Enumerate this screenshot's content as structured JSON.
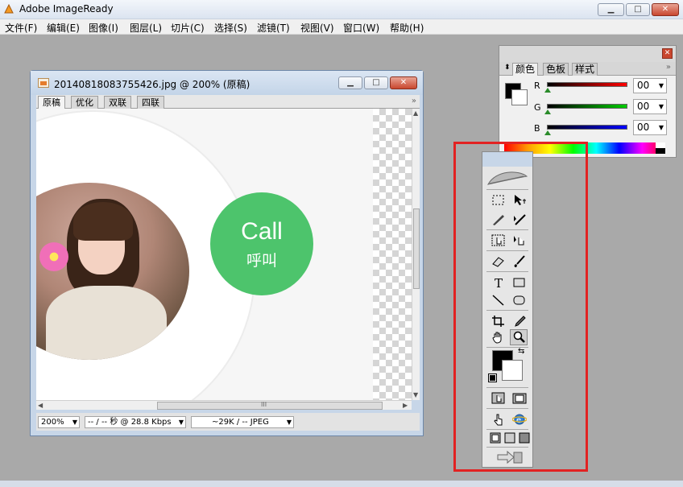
{
  "app": {
    "title": "Adobe ImageReady"
  },
  "menu": [
    "文件(F)",
    "编辑(E)",
    "图像(I)",
    "图层(L)",
    "切片(C)",
    "选择(S)",
    "滤镜(T)",
    "视图(V)",
    "窗口(W)",
    "帮助(H)"
  ],
  "document": {
    "title": "20140818083755426.jpg @ 200% (原稿)",
    "tabs": [
      "原稿",
      "优化",
      "双联",
      "四联"
    ],
    "active_tab": "原稿",
    "tabs_more": "»",
    "image": {
      "call_text": "Call",
      "call_sub": "呼叫"
    },
    "status": {
      "zoom": "200%",
      "speed": "-- / -- 秒 @ 28.8 Kbps",
      "size": "~29K / -- JPEG"
    },
    "scroll_grip": "III"
  },
  "color_panel": {
    "tabs": [
      "颜色",
      "色板",
      "样式"
    ],
    "active_tab": "颜色",
    "more": "»",
    "channels": [
      {
        "label": "R",
        "value": "00",
        "color": "#ff0000"
      },
      {
        "label": "G",
        "value": "00",
        "color": "#00cc00"
      },
      {
        "label": "B",
        "value": "00",
        "color": "#0000ff"
      }
    ],
    "foreground": "#000000",
    "background": "#ffffff"
  },
  "toolbox": {
    "tools": [
      "marquee",
      "move",
      "slice",
      "slice-select",
      "image-map",
      "image-map-select",
      "eraser",
      "brush",
      "type",
      "rectangle",
      "line",
      "rounded-rectangle",
      "crop",
      "eyedropper",
      "hand",
      "zoom",
      "toggle-image-map",
      "toggle-slices",
      "rollover-preview",
      "preview-in-browser",
      "standard-mode",
      "full-screen-menu",
      "full-screen",
      "jump-to-photoshop"
    ],
    "selected": "zoom"
  },
  "highlight_color": "#e22222"
}
